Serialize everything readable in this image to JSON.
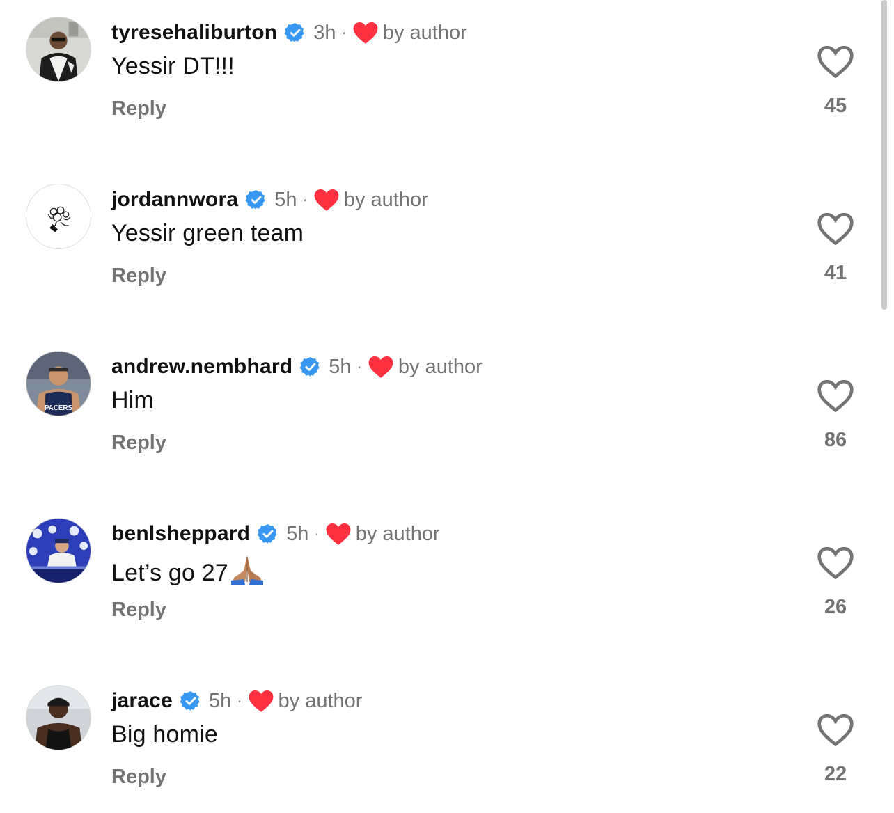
{
  "comments": [
    {
      "username": "tyresehaliburton",
      "time": "3h",
      "separator": "·",
      "liked_by_author": "by author",
      "text": "Yessir DT!!!",
      "emoji": "",
      "reply_label": "Reply",
      "likes": "45",
      "avatar_icon": "avatar-person-white-jacket"
    },
    {
      "username": "jordannwora",
      "time": "5h",
      "separator": "·",
      "liked_by_author": "by author",
      "text": "Yessir green team",
      "emoji": "",
      "reply_label": "Reply",
      "likes": "41",
      "avatar_icon": "avatar-sketch-logo"
    },
    {
      "username": "andrew.nembhard",
      "time": "5h",
      "separator": "·",
      "liked_by_author": "by author",
      "text": "Him",
      "emoji": "",
      "reply_label": "Reply",
      "likes": "86",
      "avatar_icon": "avatar-pacers-jersey"
    },
    {
      "username": "benlsheppard",
      "time": "5h",
      "separator": "·",
      "liked_by_author": "by author",
      "text": "Let’s go 27",
      "emoji": "folded-hands",
      "reply_label": "Reply",
      "likes": "26",
      "avatar_icon": "avatar-press-conference"
    },
    {
      "username": "jarace",
      "time": "5h",
      "separator": "·",
      "liked_by_author": "by author",
      "text": "Big homie",
      "emoji": "",
      "reply_label": "Reply",
      "likes": "22",
      "avatar_icon": "avatar-person-tank-top"
    }
  ],
  "colors": {
    "text_primary": "#111111",
    "text_secondary": "#737373",
    "verified_blue": "#3897f0",
    "heart_red": "#ff3040"
  }
}
